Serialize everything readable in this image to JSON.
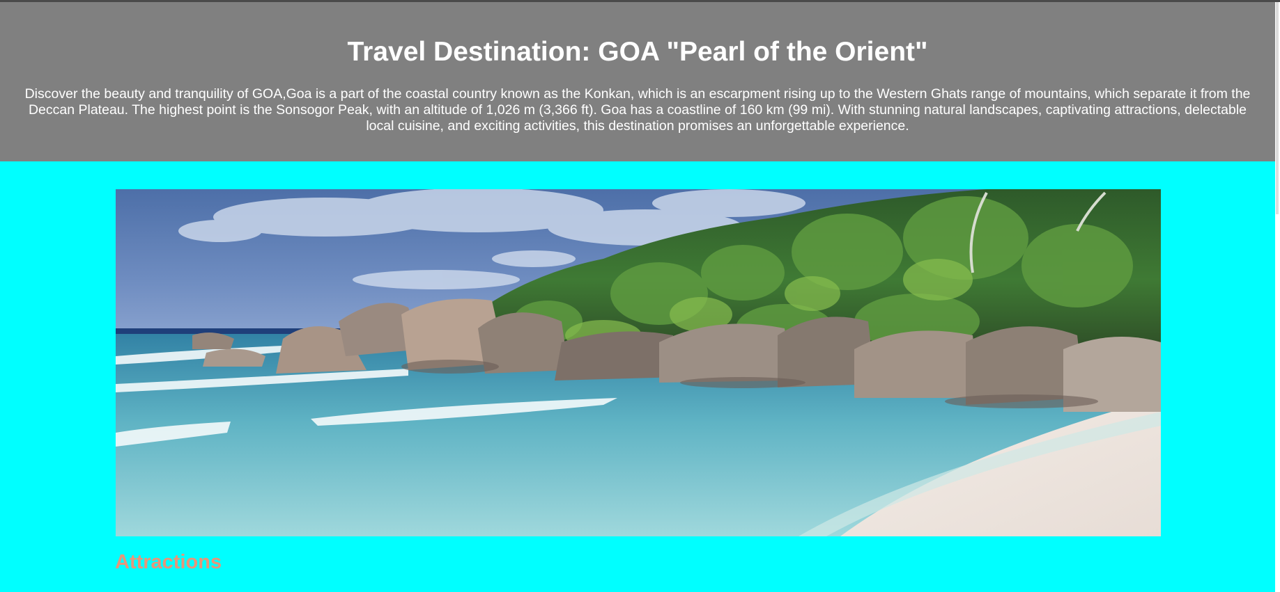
{
  "header": {
    "title": "Travel Destination: GOA \"Pearl of the Orient\"",
    "description": "Discover the beauty and tranquility of GOA,Goa is a part of the coastal country known as the Konkan, which is an escarpment rising up to the Western Ghats range of mountains, which separate it from the Deccan Plateau. The highest point is the Sonsogor Peak, with an altitude of 1,026 m (3,366 ft). Goa has a coastline of 160 km (99 mi). With stunning natural landscapes, captivating attractions, delectable local cuisine, and exciting activities, this destination promises an unforgettable experience."
  },
  "hero": {
    "alt": "beach-with-rocks-and-palm-trees"
  },
  "sections": {
    "attractions_heading": "Attractions"
  },
  "colors": {
    "page_background": "#00ffff",
    "header_background": "#808080",
    "header_text": "#ffffff",
    "section_heading": "#e6967a"
  }
}
